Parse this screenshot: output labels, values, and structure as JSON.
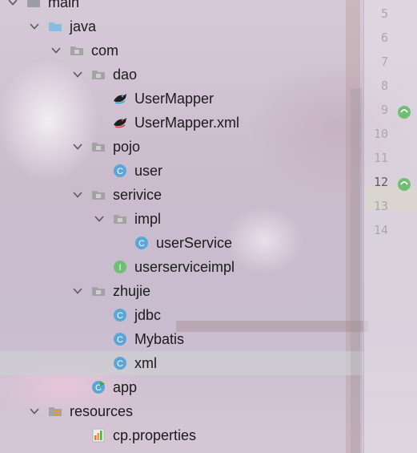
{
  "tree": [
    {
      "label": "main",
      "kind": "folder-plain",
      "indent": 1,
      "expanded": true
    },
    {
      "label": "java",
      "kind": "folder-source",
      "indent": 2,
      "expanded": true
    },
    {
      "label": "com",
      "kind": "package",
      "indent": 3,
      "expanded": true
    },
    {
      "label": "dao",
      "kind": "package",
      "indent": 4,
      "expanded": true
    },
    {
      "label": "UserMapper",
      "kind": "mybatis-mapper",
      "indent": 5
    },
    {
      "label": "UserMapper.xml",
      "kind": "mybatis-xml",
      "indent": 5
    },
    {
      "label": "pojo",
      "kind": "package",
      "indent": 4,
      "expanded": true
    },
    {
      "label": "user",
      "kind": "class",
      "indent": 5
    },
    {
      "label": "serivice",
      "kind": "package",
      "indent": 4,
      "expanded": true
    },
    {
      "label": "impl",
      "kind": "package",
      "indent": 5,
      "expanded": true
    },
    {
      "label": "userService",
      "kind": "class",
      "indent": 6
    },
    {
      "label": "userserviceimpl",
      "kind": "interface",
      "indent": 5
    },
    {
      "label": "zhujie",
      "kind": "package",
      "indent": 4,
      "expanded": true
    },
    {
      "label": "jdbc",
      "kind": "class",
      "indent": 5
    },
    {
      "label": "Mybatis",
      "kind": "class",
      "indent": 5
    },
    {
      "label": "xml",
      "kind": "class",
      "indent": 5,
      "selected": true
    },
    {
      "label": "app",
      "kind": "runnable-class",
      "indent": 4
    },
    {
      "label": "resources",
      "kind": "resources",
      "indent": 2,
      "expanded": true
    },
    {
      "label": "cp.properties",
      "kind": "properties-file",
      "indent": 4
    }
  ],
  "gutter": {
    "lines": [
      "5",
      "6",
      "7",
      "8",
      "9",
      "10",
      "11",
      "12",
      "13",
      "14"
    ],
    "active_line": "12",
    "markers": [
      {
        "line": "9",
        "icon": "bean-search-icon"
      },
      {
        "line": "12",
        "icon": "bean-check-icon"
      }
    ]
  },
  "colors": {
    "class": "#5aa6d6",
    "interface": "#6fbf73",
    "package": "#9a9a9a",
    "source-folder": "#86bde0",
    "selected_row": "#cdcdd2"
  }
}
